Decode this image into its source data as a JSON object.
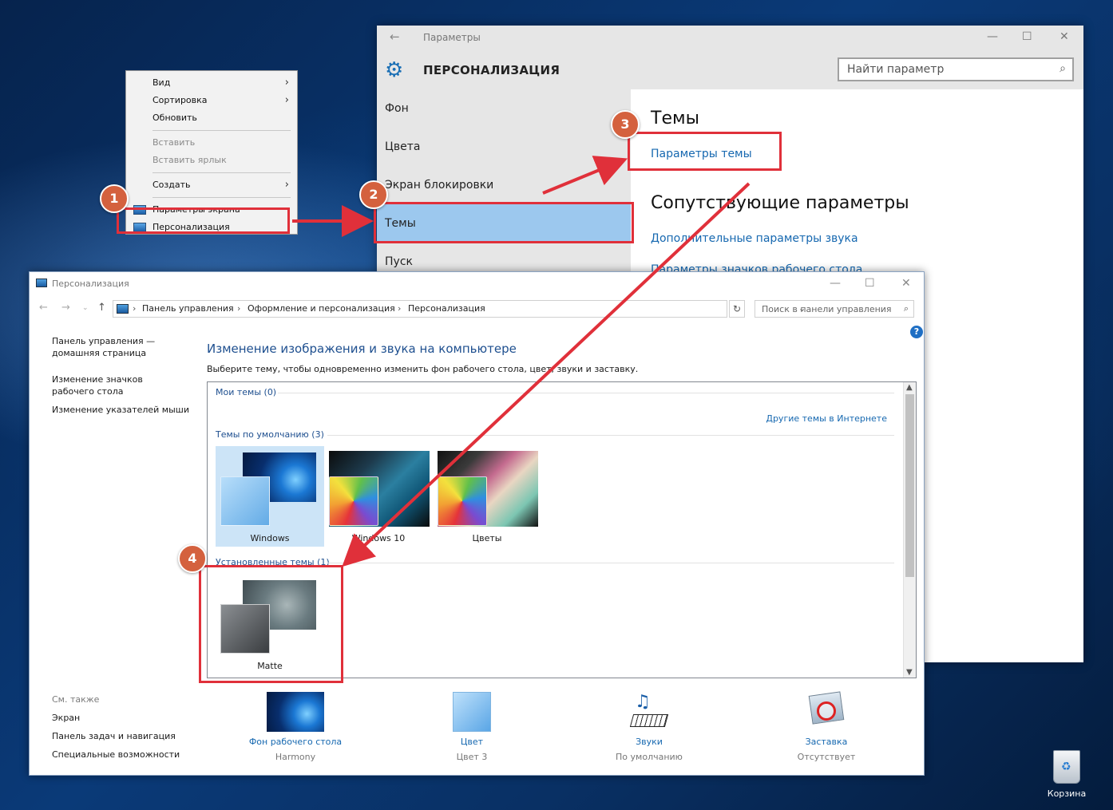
{
  "context_menu": {
    "items": [
      {
        "label": "Вид",
        "submenu": true
      },
      {
        "label": "Сортировка",
        "submenu": true
      },
      {
        "label": "Обновить"
      },
      {
        "label": "Вставить",
        "disabled": true
      },
      {
        "label": "Вставить ярлык",
        "disabled": true
      },
      {
        "label": "Создать",
        "submenu": true
      },
      {
        "label": "Параметры экрана"
      },
      {
        "label": "Персонализация"
      }
    ]
  },
  "settings": {
    "window_title": "Параметры",
    "header": "ПЕРСОНАЛИЗАЦИЯ",
    "search_placeholder": "Найти параметр",
    "nav": [
      "Фон",
      "Цвета",
      "Экран блокировки",
      "Темы",
      "Пуск"
    ],
    "selected_nav": "Темы",
    "themes_heading": "Темы",
    "theme_settings_link": "Параметры темы",
    "related_heading": "Сопутствующие параметры",
    "related_links": [
      "Дополнительные параметры звука",
      "Параметры значков рабочего стола"
    ]
  },
  "control_panel": {
    "window_title": "Персонализация",
    "breadcrumb": [
      "Панель управления",
      "Оформление и персонализация",
      "Персонализация"
    ],
    "search_placeholder": "Поиск в панели управления",
    "help": "?",
    "sidebar": {
      "home": "Панель управления — домашняя страница",
      "links": [
        "Изменение значков рабочего стола",
        "Изменение указателей мыши"
      ],
      "see_also_title": "См. также",
      "see_also": [
        "Экран",
        "Панель задач и навигация",
        "Специальные возможности"
      ]
    },
    "heading": "Изменение изображения и звука на компьютере",
    "subheading": "Выберите тему, чтобы одновременно изменить фон рабочего стола, цвет, звуки и заставку.",
    "groups": {
      "my_themes": "Мои темы (0)",
      "more_themes_link": "Другие темы в Интернете",
      "default_themes": "Темы по умолчанию (3)",
      "installed_themes": "Установленные темы (1)"
    },
    "default_themes": [
      "Windows",
      "Windows 10",
      "Цветы"
    ],
    "installed_themes": [
      "Matte"
    ],
    "selected_theme": "Windows",
    "bottom": [
      {
        "label": "Фон рабочего стола",
        "value": "Harmony"
      },
      {
        "label": "Цвет",
        "value": "Цвет 3"
      },
      {
        "label": "Звуки",
        "value": "По умолчанию"
      },
      {
        "label": "Заставка",
        "value": "Отсутствует"
      }
    ]
  },
  "annotations": {
    "steps": [
      "1",
      "2",
      "3",
      "4"
    ],
    "highlight_color": "#e0303a",
    "badge_color": "#d4613e"
  },
  "desktop": {
    "recycle_bin": "Корзина"
  }
}
